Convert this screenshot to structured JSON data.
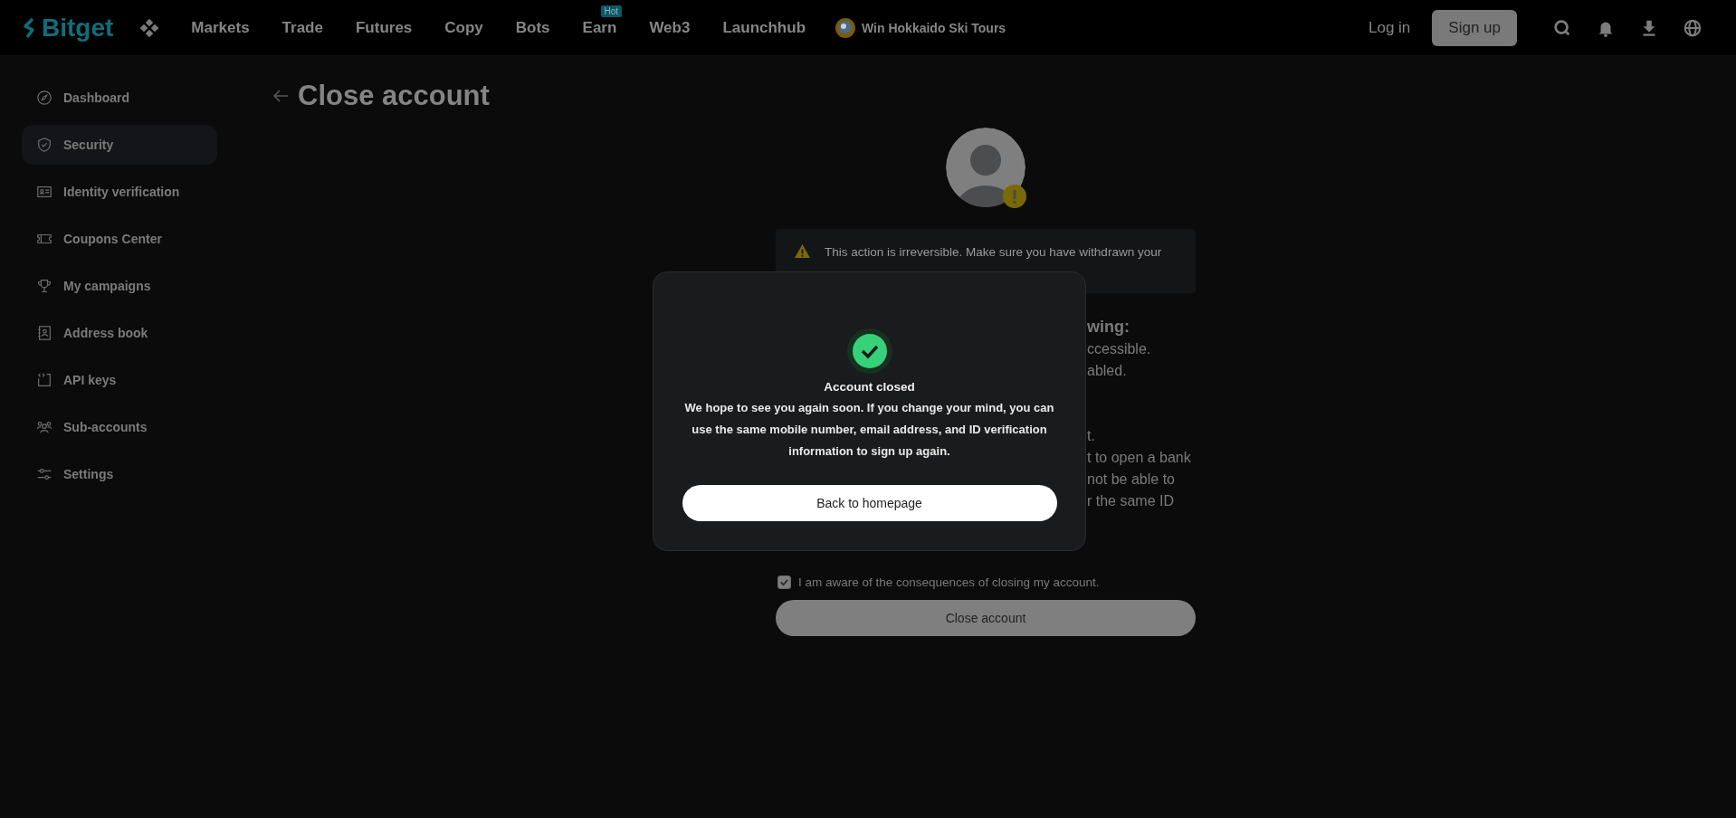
{
  "navbar": {
    "logo": "Bitget",
    "menu": [
      {
        "label": "Markets"
      },
      {
        "label": "Trade"
      },
      {
        "label": "Futures"
      },
      {
        "label": "Copy"
      },
      {
        "label": "Bots"
      },
      {
        "label": "Earn",
        "badge": "Hot"
      },
      {
        "label": "Web3"
      },
      {
        "label": "Launchhub"
      }
    ],
    "promo": "Win Hokkaido Ski Tours",
    "login": "Log in",
    "signup": "Sign up"
  },
  "sidebar": {
    "items": [
      {
        "label": "Dashboard",
        "selected": false
      },
      {
        "label": "Security",
        "selected": true
      },
      {
        "label": "Identity verification",
        "selected": false
      },
      {
        "label": "Coupons Center",
        "selected": false
      },
      {
        "label": "My campaigns",
        "selected": false
      },
      {
        "label": "Address book",
        "selected": false
      },
      {
        "label": "API keys",
        "selected": false
      },
      {
        "label": "Sub-accounts",
        "selected": false
      },
      {
        "label": "Settings",
        "selected": false
      }
    ]
  },
  "page": {
    "title": "Close account",
    "warning": "This action is irreversible. Make sure you have withdrawn your",
    "partly_hidden_text": [
      {
        "kind": "heading",
        "lines": [
          "wing:"
        ]
      },
      {
        "kind": "body",
        "lines": [
          "ccessible.",
          "abled."
        ]
      },
      {
        "kind": "body",
        "lines": [
          "t.",
          "t to open a bank",
          "not be able to",
          "r the same ID"
        ]
      }
    ],
    "consent": {
      "label": "I am aware of the consequences of closing my account.",
      "checked": true
    },
    "close_button": "Close account"
  },
  "dialog": {
    "title": "Account closed",
    "message": "We hope to see you again soon. If you change your mind, you can use the same mobile number, email address, and ID verification information to sign up again.",
    "button": "Back to homepage"
  }
}
